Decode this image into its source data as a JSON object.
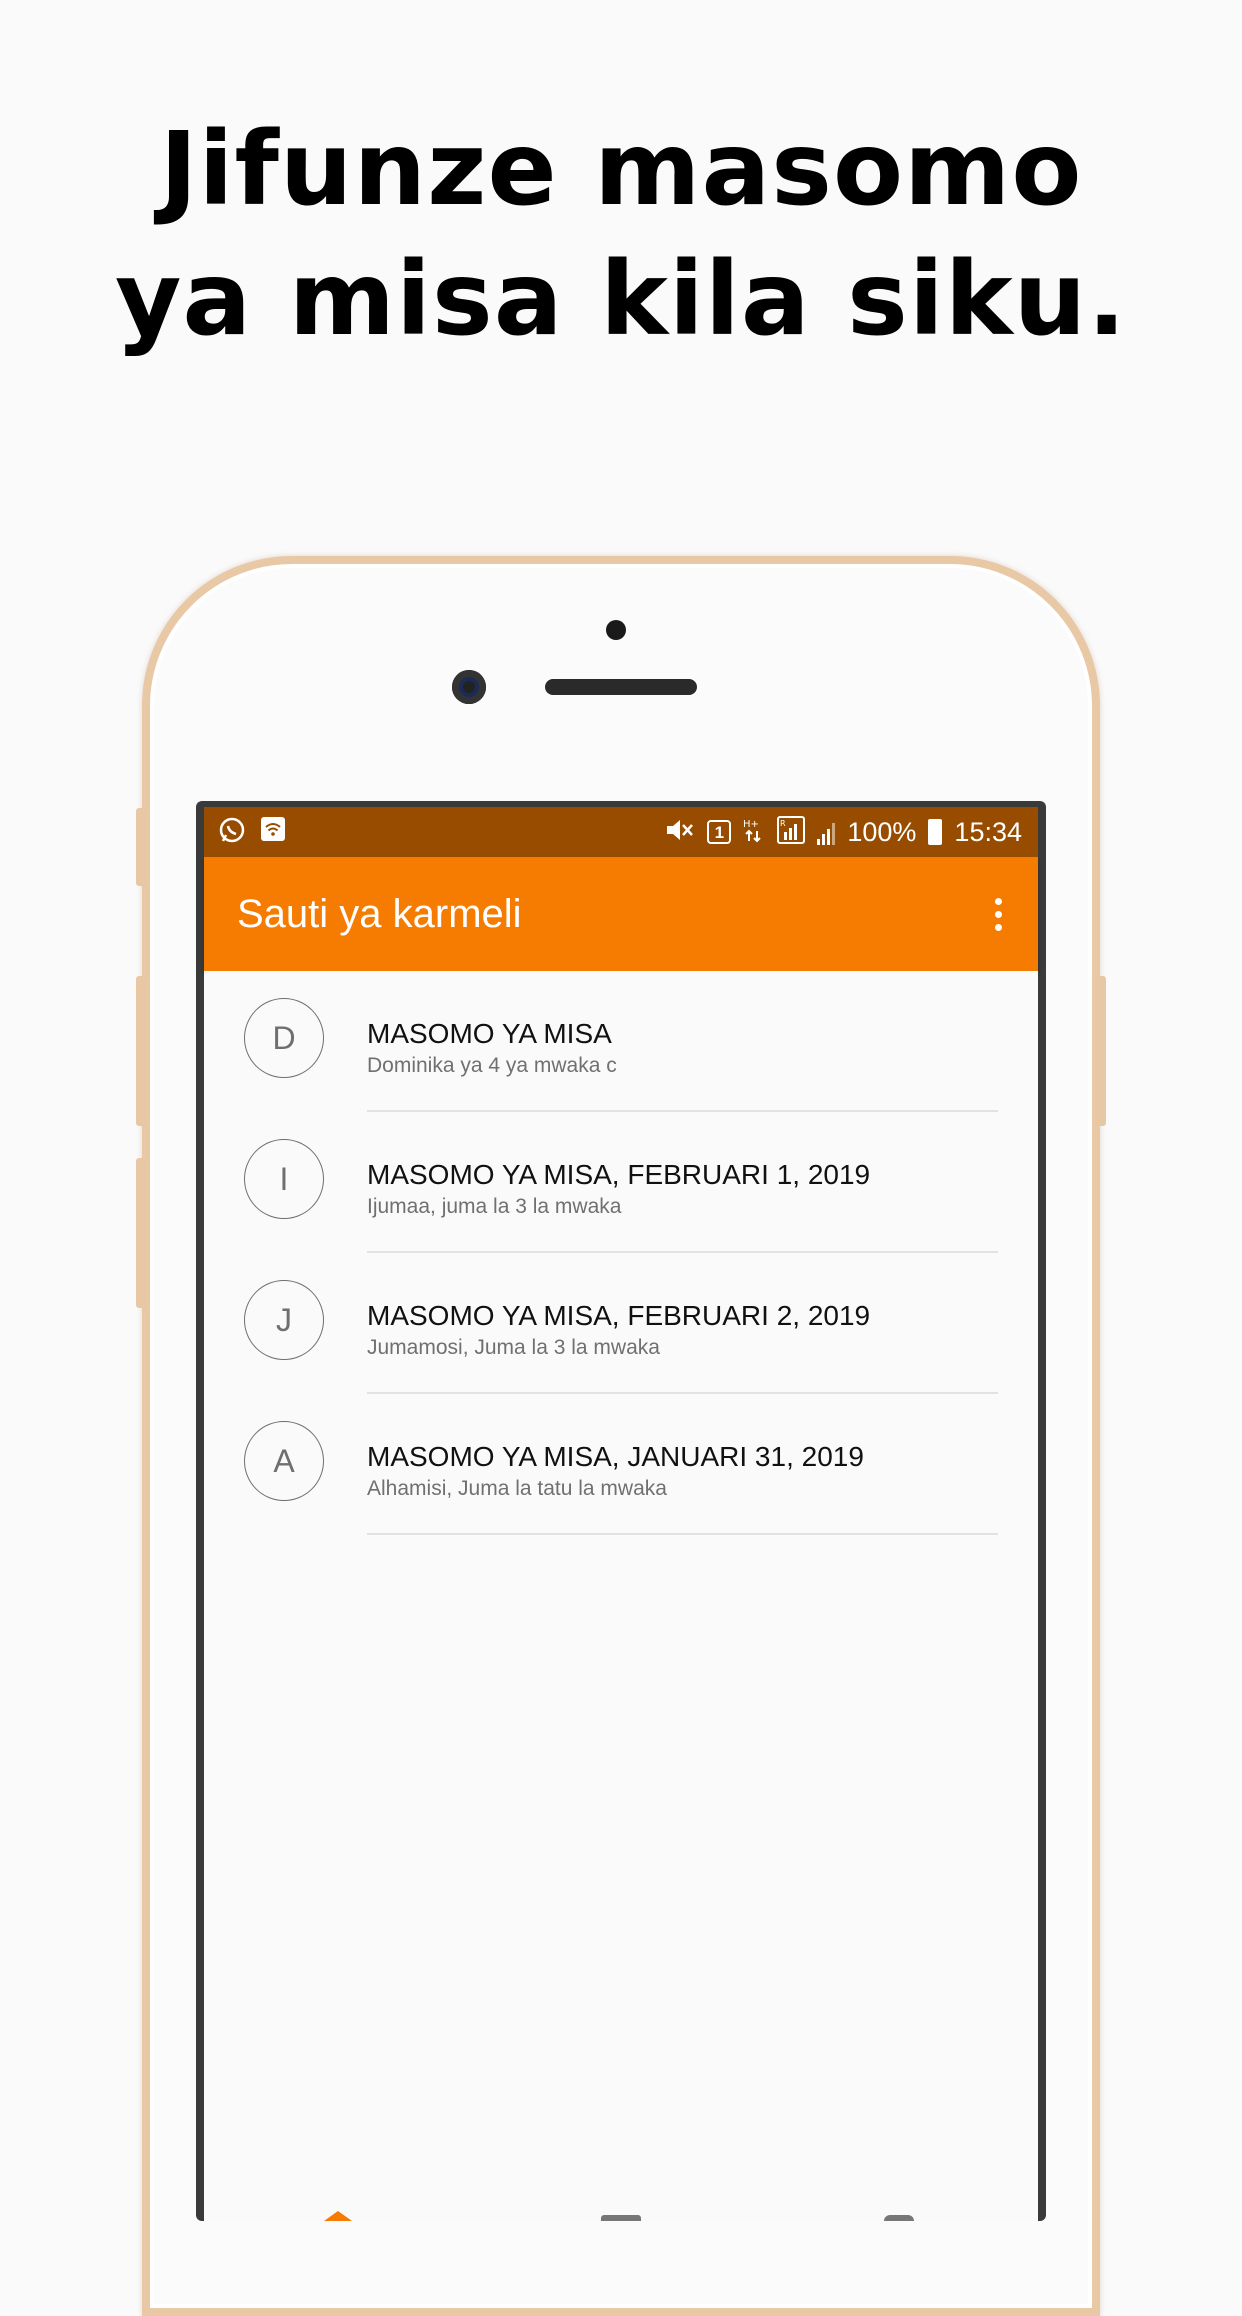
{
  "headline": {
    "line1": "Jifunze masomo",
    "line2": "ya misa kila siku."
  },
  "status_bar": {
    "left_icons": [
      "whatsapp-icon",
      "wifi-icon"
    ],
    "sim_label": "1",
    "battery_percent": "100%",
    "time": "15:34"
  },
  "app_bar": {
    "title": "Sauti ya karmeli",
    "overflow_icon": "more-vert-icon"
  },
  "colors": {
    "status_bar": "#974c00",
    "app_bar": "#f57c00",
    "phone_frame": "#e9c8a6"
  },
  "list": {
    "items": [
      {
        "initial": "D",
        "title": "MASOMO YA MISA",
        "subtitle": "Dominika ya 4 ya mwaka c"
      },
      {
        "initial": "I",
        "title": "MASOMO YA MISA, FEBRUARI 1, 2019",
        "subtitle": "Ijumaa, juma la 3 la mwaka"
      },
      {
        "initial": "J",
        "title": "MASOMO YA MISA, FEBRUARI 2, 2019",
        "subtitle": "Jumamosi, Juma la 3 la mwaka"
      },
      {
        "initial": "A",
        "title": "MASOMO YA MISA, JANUARI 31, 2019",
        "subtitle": "Alhamisi, Juma la tatu la mwaka"
      }
    ]
  }
}
